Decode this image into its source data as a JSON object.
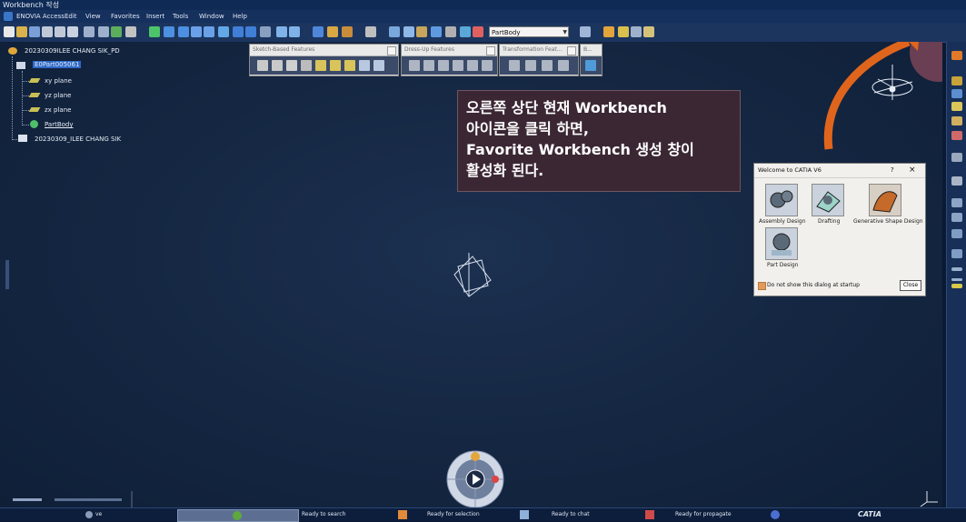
{
  "window": {
    "title": "Workbench 작성"
  },
  "menu": [
    "ENOVIA Access",
    "Edit",
    "View",
    "Favorites",
    "Insert",
    "Tools",
    "Window",
    "Help"
  ],
  "toolbar": {
    "context_combo_value": "PartBody"
  },
  "tree": {
    "root_label": "20230309ILEE CHANG SIK_PD",
    "part_label": "E0Part005061",
    "children": [
      "xy plane",
      "yz plane",
      "zx plane",
      "PartBody"
    ],
    "second_root_label": "20230309_ILEE CHANG SIK"
  },
  "floating_toolbars": [
    {
      "title": "Sketch-Based Features"
    },
    {
      "title": "Dress-Up Features"
    },
    {
      "title": "Transformation Feat..."
    },
    {
      "title": "B..."
    }
  ],
  "info_box": {
    "lines": [
      "오른쪽 상단 현재 Workbench",
      "아이콘을 클릭 하면,",
      "Favorite Workbench 생성 창이",
      "활성화 된다."
    ]
  },
  "welcome_dialog": {
    "title": "Welcome to CATIA V6",
    "help_label": "?",
    "close_x": "×",
    "items": [
      "Assembly Design",
      "Drafting",
      "Generative Shape Design",
      "Part Design"
    ],
    "checkbox_label": "Do not show this dialog at startup",
    "close_button": "Close"
  },
  "statusbar": {
    "left_label": "ve",
    "search_status": "Ready to search",
    "selection_status": "Ready for selection",
    "chat_status": "Ready to chat",
    "propagate_status": "Ready for propagate",
    "brand": "CATIA"
  },
  "colors": {
    "viewport": "#142641",
    "annotation_box": "#3b2733",
    "arrow": "#e0651c",
    "highlight_circle": "#7a4458"
  }
}
